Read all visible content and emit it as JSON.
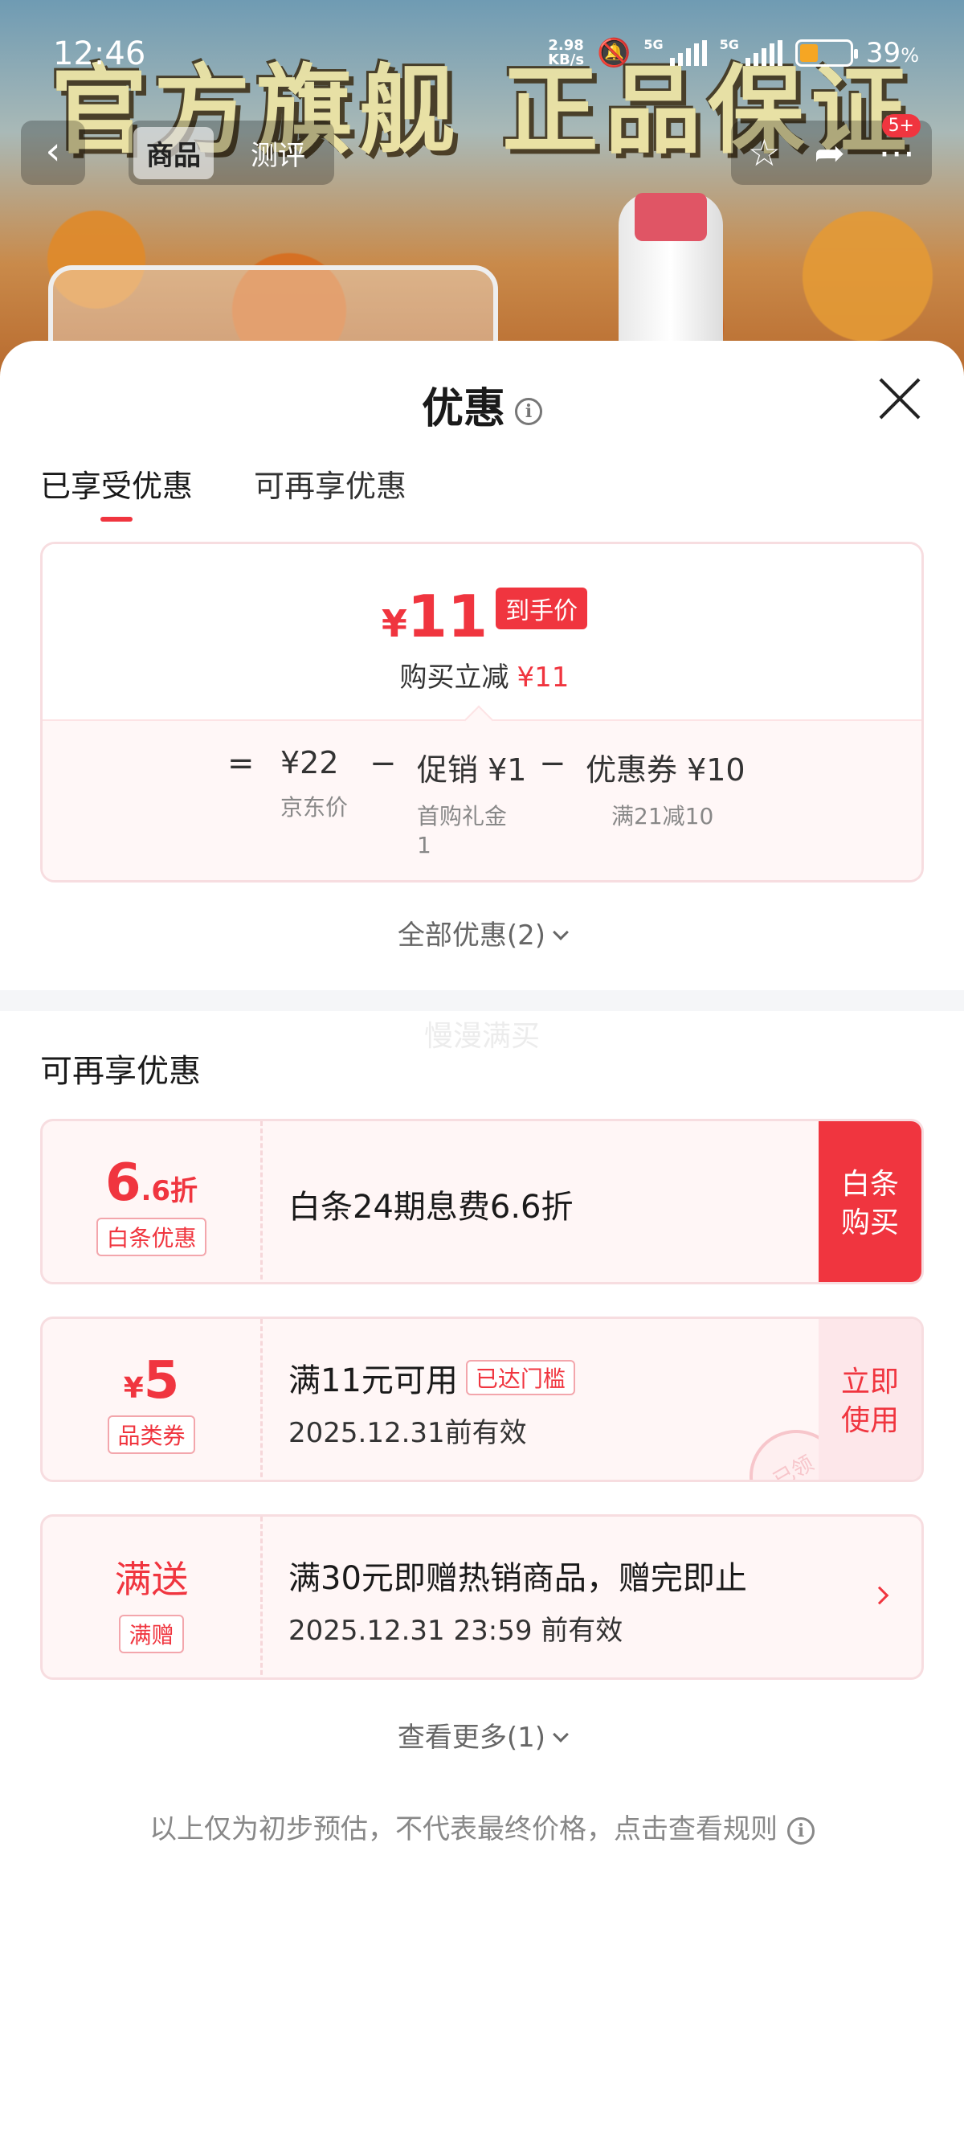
{
  "status_bar": {
    "time": "12:46",
    "net_speed_top": "2.98",
    "net_speed_bottom": "KB/s",
    "signal1": "5G",
    "signal2": "5G",
    "battery_level": "39",
    "battery_unit": "%"
  },
  "banner": {
    "promo_text": "官方旗舰 正品保证"
  },
  "nav": {
    "tabs": [
      "商品",
      "测评"
    ],
    "badge": "5+",
    "icons": [
      "chevron-left-icon",
      "star-icon",
      "share-icon",
      "more-icon"
    ]
  },
  "sheet": {
    "title": "优惠",
    "tabs": [
      "已享受优惠",
      "可再享优惠"
    ],
    "summary": {
      "currency": "¥",
      "final_price": "11",
      "final_tag": "到手价",
      "instant_label": "购买立减",
      "instant_value": "¥11",
      "calc": {
        "eq": "=",
        "minus": "−",
        "jd_price": "¥22",
        "jd_price_label": "京东价",
        "promo": "促销 ¥1",
        "promo_label": "首购礼金",
        "promo_label_2": "1",
        "coupon": "优惠券 ¥10",
        "coupon_label": "满21减10"
      }
    },
    "all_discount": "全部优惠(2)",
    "ghost_text": "慢漫满买",
    "section_title": "可再享优惠",
    "coupons": [
      {
        "value_big": "6",
        "value_small": ".6折",
        "tag": "白条优惠",
        "line1": "白条24期息费6.6折",
        "action": [
          "白条",
          "购买"
        ]
      },
      {
        "currency": "¥",
        "value_big": "5",
        "tag": "品类券",
        "line1": "满11元可用",
        "reached": "已达门槛",
        "line2": "2025.12.31前有效",
        "action": [
          "立即",
          "使用"
        ],
        "stamp": "已领"
      },
      {
        "value_big": "满送",
        "tag": "满赠",
        "line1": "满30元即赠热销商品，赠完即止",
        "line2": "2025.12.31 23:59 前有效"
      }
    ],
    "see_more": "查看更多(1)",
    "disclaimer": "以上仅为初步预估，不代表最终价格，点击查看规则"
  },
  "colors": {
    "accent": "#f0353f",
    "card_bg": "#fff6f6",
    "card_border": "#f7dde0"
  }
}
